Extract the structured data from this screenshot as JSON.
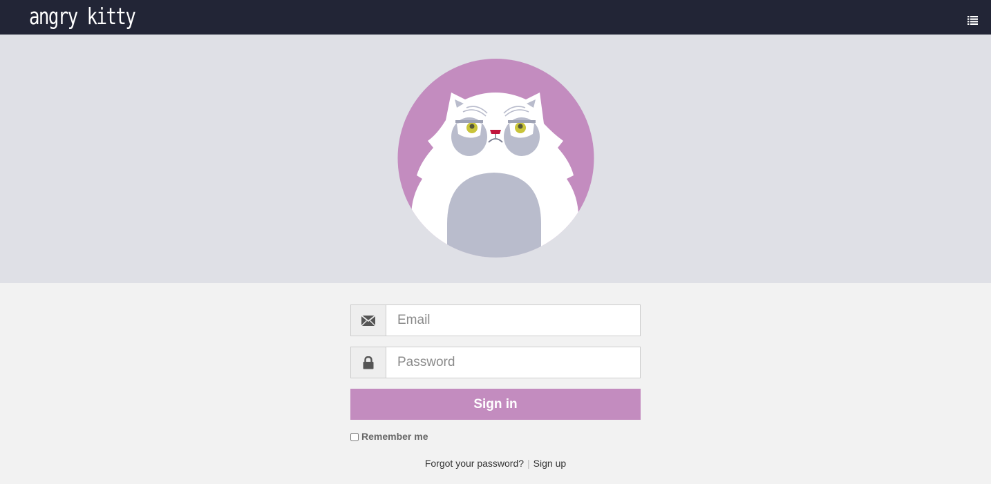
{
  "navbar": {
    "brand": "angry kitty",
    "menu_icon": "list-icon",
    "background": "#222536"
  },
  "hero": {
    "background": "#dfe0e6",
    "avatar": "angry-kitty-avatar",
    "avatar_circle_color": "#c38cbf"
  },
  "login": {
    "email_icon": "envelope-icon",
    "email_placeholder": "Email",
    "email_value": "",
    "password_icon": "lock-icon",
    "password_placeholder": "Password",
    "password_value": "",
    "signin_label": "Sign in",
    "signin_color": "#c38cbf",
    "remember_label": "Remember me",
    "remember_checked": false
  },
  "links": {
    "forgot": "Forgot your password?",
    "separator": "|",
    "signup": "Sign up"
  }
}
